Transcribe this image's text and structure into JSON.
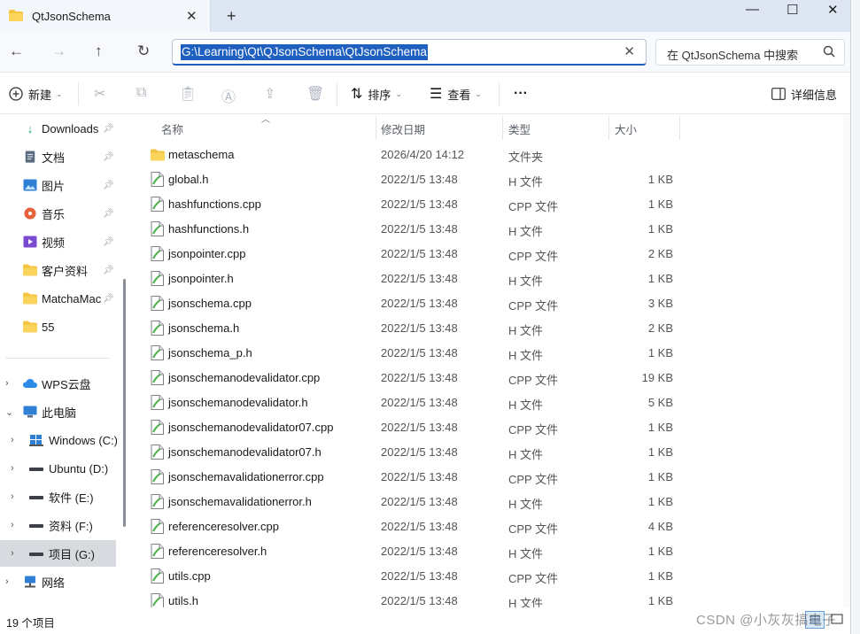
{
  "window": {
    "tab_title": "QtJsonSchema",
    "tab_close": "✕",
    "new_tab": "+",
    "minimize": "—",
    "maximize": "☐",
    "close": "✕"
  },
  "nav": {
    "back": "←",
    "forward": "→",
    "up": "↑",
    "refresh": "↻"
  },
  "address": {
    "path": "G:\\Learning\\Qt\\QJsonSchema\\QtJsonSchema",
    "clear": "✕"
  },
  "search": {
    "placeholder": "在 QtJsonSchema 中搜索"
  },
  "toolbar": {
    "new_label": "新建",
    "sort_label": "排序",
    "view_label": "查看",
    "more_label": "···",
    "details_label": "详细信息"
  },
  "sidebar": {
    "items": [
      {
        "label": "Downloads",
        "icon": "download-icon",
        "pinned": true
      },
      {
        "label": "文档",
        "icon": "document-icon",
        "pinned": true
      },
      {
        "label": "图片",
        "icon": "picture-icon",
        "pinned": true
      },
      {
        "label": "音乐",
        "icon": "music-icon",
        "pinned": true
      },
      {
        "label": "视频",
        "icon": "video-icon",
        "pinned": true
      },
      {
        "label": "客户资料",
        "icon": "folder-icon",
        "pinned": true
      },
      {
        "label": "MatchaMac",
        "icon": "folder-icon",
        "pinned": true
      },
      {
        "label": "55",
        "icon": "folder-icon",
        "pinned": false
      },
      {
        "label": "WPS云盘",
        "icon": "cloud-icon",
        "pinned": false
      },
      {
        "label": "此电脑",
        "icon": "computer-icon",
        "pinned": false
      },
      {
        "label": "Windows (C:)",
        "icon": "windows-drive-icon",
        "pinned": false
      },
      {
        "label": "Ubuntu (D:)",
        "icon": "drive-icon",
        "pinned": false
      },
      {
        "label": "软件 (E:)",
        "icon": "drive-icon",
        "pinned": false
      },
      {
        "label": "资料 (F:)",
        "icon": "drive-icon",
        "pinned": false
      },
      {
        "label": "项目 (G:)",
        "icon": "drive-icon",
        "pinned": false
      },
      {
        "label": "网络",
        "icon": "network-icon",
        "pinned": false
      }
    ]
  },
  "columns": {
    "name": "名称",
    "date": "修改日期",
    "type": "类型",
    "size": "大小"
  },
  "files": [
    {
      "name": "metaschema",
      "date": "2026/4/20 14:12",
      "type": "文件夹",
      "size": "",
      "kind": "folder"
    },
    {
      "name": "global.h",
      "date": "2022/1/5 13:48",
      "type": "H 文件",
      "size": "1 KB",
      "kind": "file"
    },
    {
      "name": "hashfunctions.cpp",
      "date": "2022/1/5 13:48",
      "type": "CPP 文件",
      "size": "1 KB",
      "kind": "file"
    },
    {
      "name": "hashfunctions.h",
      "date": "2022/1/5 13:48",
      "type": "H 文件",
      "size": "1 KB",
      "kind": "file"
    },
    {
      "name": "jsonpointer.cpp",
      "date": "2022/1/5 13:48",
      "type": "CPP 文件",
      "size": "2 KB",
      "kind": "file"
    },
    {
      "name": "jsonpointer.h",
      "date": "2022/1/5 13:48",
      "type": "H 文件",
      "size": "1 KB",
      "kind": "file"
    },
    {
      "name": "jsonschema.cpp",
      "date": "2022/1/5 13:48",
      "type": "CPP 文件",
      "size": "3 KB",
      "kind": "file"
    },
    {
      "name": "jsonschema.h",
      "date": "2022/1/5 13:48",
      "type": "H 文件",
      "size": "2 KB",
      "kind": "file"
    },
    {
      "name": "jsonschema_p.h",
      "date": "2022/1/5 13:48",
      "type": "H 文件",
      "size": "1 KB",
      "kind": "file"
    },
    {
      "name": "jsonschemanodevalidator.cpp",
      "date": "2022/1/5 13:48",
      "type": "CPP 文件",
      "size": "19 KB",
      "kind": "file"
    },
    {
      "name": "jsonschemanodevalidator.h",
      "date": "2022/1/5 13:48",
      "type": "H 文件",
      "size": "5 KB",
      "kind": "file"
    },
    {
      "name": "jsonschemanodevalidator07.cpp",
      "date": "2022/1/5 13:48",
      "type": "CPP 文件",
      "size": "1 KB",
      "kind": "file"
    },
    {
      "name": "jsonschemanodevalidator07.h",
      "date": "2022/1/5 13:48",
      "type": "H 文件",
      "size": "1 KB",
      "kind": "file"
    },
    {
      "name": "jsonschemavalidationerror.cpp",
      "date": "2022/1/5 13:48",
      "type": "CPP 文件",
      "size": "1 KB",
      "kind": "file"
    },
    {
      "name": "jsonschemavalidationerror.h",
      "date": "2022/1/5 13:48",
      "type": "H 文件",
      "size": "1 KB",
      "kind": "file"
    },
    {
      "name": "referenceresolver.cpp",
      "date": "2022/1/5 13:48",
      "type": "CPP 文件",
      "size": "4 KB",
      "kind": "file"
    },
    {
      "name": "referenceresolver.h",
      "date": "2022/1/5 13:48",
      "type": "H 文件",
      "size": "1 KB",
      "kind": "file"
    },
    {
      "name": "utils.cpp",
      "date": "2022/1/5 13:48",
      "type": "CPP 文件",
      "size": "1 KB",
      "kind": "file"
    },
    {
      "name": "utils.h",
      "date": "2022/1/5 13:48",
      "type": "H 文件",
      "size": "1 KB",
      "kind": "file"
    }
  ],
  "status": {
    "item_count": "19 个项目"
  },
  "watermark": "CSDN @小灰灰搞电子",
  "colors": {
    "accent": "#1e5fbf",
    "folder": "#f4c542",
    "selected_nav": "#d7dbe0"
  }
}
